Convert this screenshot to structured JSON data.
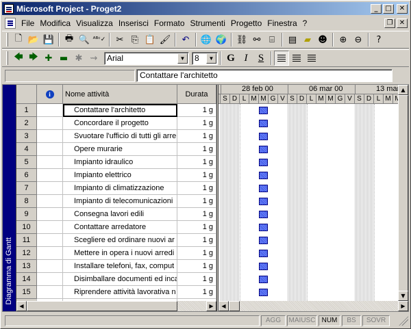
{
  "window": {
    "title": "Microsoft Project - Proget2"
  },
  "menu": [
    "File",
    "Modifica",
    "Visualizza",
    "Inserisci",
    "Formato",
    "Strumenti",
    "Progetto",
    "Finestra",
    "?"
  ],
  "font": {
    "name": "Arial",
    "size": "8"
  },
  "format_buttons": {
    "bold": "G",
    "italic": "I",
    "underline": "S"
  },
  "entry": {
    "value": "Contattare l'architetto"
  },
  "view_bar": {
    "label": "Diagramma di Gantt"
  },
  "table": {
    "columns": {
      "info": "i",
      "name": "Nome attività",
      "duration": "Durata"
    },
    "rows": [
      {
        "id": "1",
        "name": "Contattare l'architetto",
        "duration": "1 g"
      },
      {
        "id": "2",
        "name": "Concordare il progetto",
        "duration": "1 g"
      },
      {
        "id": "3",
        "name": "Svuotare l'ufficio di tutti gli arre",
        "duration": "1 g"
      },
      {
        "id": "4",
        "name": "Opere murarie",
        "duration": "1 g"
      },
      {
        "id": "5",
        "name": "Impianto idraulico",
        "duration": "1 g"
      },
      {
        "id": "6",
        "name": "Impianto elettrico",
        "duration": "1 g"
      },
      {
        "id": "7",
        "name": "Impianto di climatizzazione",
        "duration": "1 g"
      },
      {
        "id": "8",
        "name": "Impianto di telecomunicazioni",
        "duration": "1 g"
      },
      {
        "id": "9",
        "name": "Consegna lavori edili",
        "duration": "1 g"
      },
      {
        "id": "10",
        "name": "Contattare arredatore",
        "duration": "1 g"
      },
      {
        "id": "11",
        "name": "Scegliere ed ordinare nuovi ar",
        "duration": "1 g"
      },
      {
        "id": "12",
        "name": "Mettere in opera i nuovi arredi",
        "duration": "1 g"
      },
      {
        "id": "13",
        "name": "Installare telefoni, fax, comput",
        "duration": "1 g"
      },
      {
        "id": "14",
        "name": "Disimballare documenti ed inca",
        "duration": "1 g"
      },
      {
        "id": "15",
        "name": "Riprendere attività lavorativa n",
        "duration": "1 g"
      }
    ]
  },
  "gantt": {
    "weeks": [
      "28 feb 00",
      "06 mar 00",
      "13 mar"
    ],
    "days": [
      "S",
      "D",
      "L",
      "M",
      "M",
      "G",
      "V",
      "S",
      "D",
      "L",
      "M",
      "M",
      "G",
      "V",
      "S",
      "D",
      "L",
      "M",
      "M"
    ]
  },
  "status": {
    "agg": "AGG",
    "maiusc": "MAIUSC",
    "num": "NUM",
    "bs": "BS",
    "sovr": "SOVR"
  },
  "colors": {
    "titlebar": "#0a246a",
    "viewbar": "#000080",
    "task_bar": "#3050e0"
  }
}
